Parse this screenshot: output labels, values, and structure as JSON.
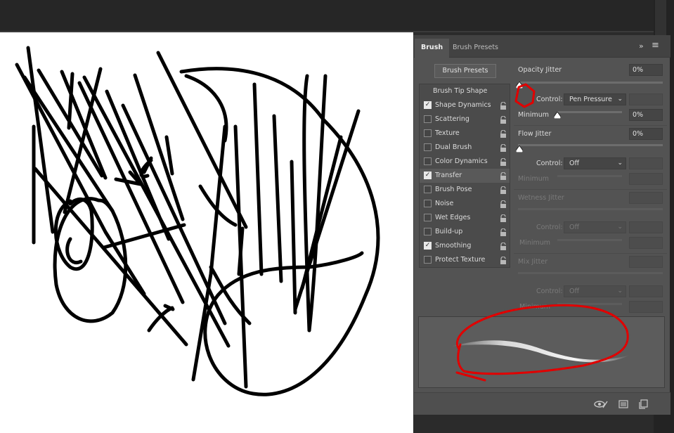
{
  "panel": {
    "tabs": [
      {
        "label": "Brush",
        "active": true
      },
      {
        "label": "Brush Presets",
        "active": false
      }
    ],
    "collapse_icon": "double-chevron-right-icon",
    "menu_icon": "hamburger-menu-icon",
    "brush_presets_button": "Brush Presets",
    "options_header": "Brush Tip Shape",
    "options": [
      {
        "label": "Shape Dynamics",
        "checked": true,
        "selected": false
      },
      {
        "label": "Scattering",
        "checked": false,
        "selected": false
      },
      {
        "label": "Texture",
        "checked": false,
        "selected": false
      },
      {
        "label": "Dual Brush",
        "checked": false,
        "selected": false
      },
      {
        "label": "Color Dynamics",
        "checked": false,
        "selected": false
      },
      {
        "label": "Transfer",
        "checked": true,
        "selected": true
      },
      {
        "label": "Brush Pose",
        "checked": false,
        "selected": false
      },
      {
        "label": "Noise",
        "checked": false,
        "selected": false
      },
      {
        "label": "Wet Edges",
        "checked": false,
        "selected": false
      },
      {
        "label": "Build-up",
        "checked": false,
        "selected": false
      },
      {
        "label": "Smoothing",
        "checked": true,
        "selected": false
      },
      {
        "label": "Protect Texture",
        "checked": false,
        "selected": false
      }
    ],
    "settings": {
      "opacity_jitter": {
        "label": "Opacity Jitter",
        "value": "0%"
      },
      "opacity_control": {
        "label": "Control:",
        "value": "Pen Pressure"
      },
      "opacity_minimum": {
        "label": "Minimum",
        "value": "0%"
      },
      "flow_jitter": {
        "label": "Flow Jitter",
        "value": "0%"
      },
      "flow_control": {
        "label": "Control:",
        "value": "Off"
      },
      "flow_minimum": {
        "label": "Minimum",
        "value": ""
      },
      "wetness_jitter": {
        "label": "Wetness Jitter",
        "value": ""
      },
      "wetness_control": {
        "label": "Control:",
        "value": "Off"
      },
      "wetness_minimum": {
        "label": "Minimum",
        "value": ""
      },
      "mix_jitter": {
        "label": "Mix Jitter",
        "value": ""
      },
      "mix_control": {
        "label": "Control:",
        "value": "Off"
      },
      "mix_minimum": {
        "label": "Minimum",
        "value": ""
      }
    },
    "bottom_icons": [
      "toggle-preview-icon",
      "brush-grid-icon",
      "new-preset-icon"
    ]
  },
  "colors": {
    "annotation": "#e10000",
    "panel_bg": "#535353",
    "canvas_bg": "#ffffff"
  }
}
